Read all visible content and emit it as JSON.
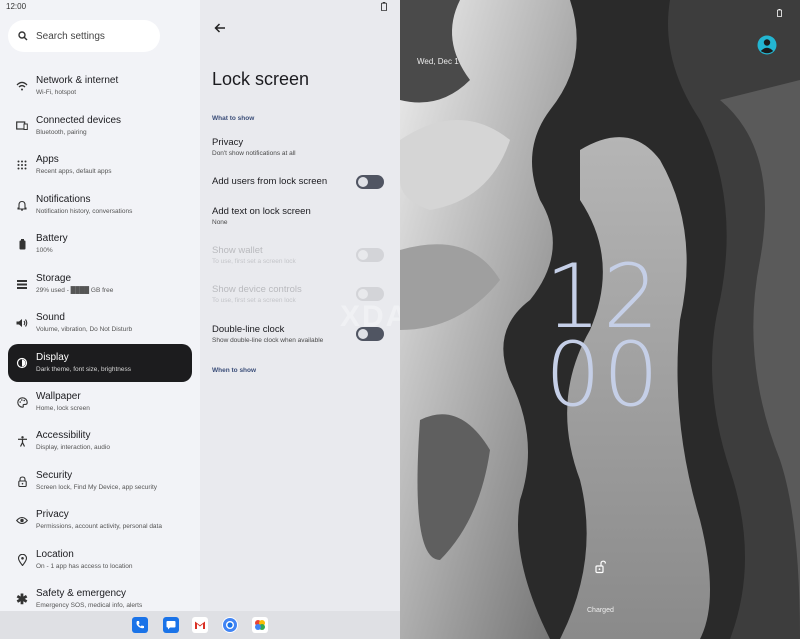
{
  "status": {
    "time": "12:00"
  },
  "search": {
    "placeholder": "Search settings"
  },
  "nav": [
    {
      "title": "Network & internet",
      "sub": "Wi-Fi, hotspot",
      "icon": "wifi-icon"
    },
    {
      "title": "Connected devices",
      "sub": "Bluetooth, pairing",
      "icon": "devices-icon"
    },
    {
      "title": "Apps",
      "sub": "Recent apps, default apps",
      "icon": "apps-grid-icon"
    },
    {
      "title": "Notifications",
      "sub": "Notification history, conversations",
      "icon": "bell-icon"
    },
    {
      "title": "Battery",
      "sub": "100%",
      "icon": "battery-icon"
    },
    {
      "title": "Storage",
      "sub": "29% used - ████ GB free",
      "icon": "storage-icon"
    },
    {
      "title": "Sound",
      "sub": "Volume, vibration, Do Not Disturb",
      "icon": "speaker-icon"
    },
    {
      "title": "Display",
      "sub": "Dark theme, font size, brightness",
      "icon": "brightness-icon"
    },
    {
      "title": "Wallpaper",
      "sub": "Home, lock screen",
      "icon": "palette-icon"
    },
    {
      "title": "Accessibility",
      "sub": "Display, interaction, audio",
      "icon": "accessibility-icon"
    },
    {
      "title": "Security",
      "sub": "Screen lock, Find My Device, app security",
      "icon": "lock-icon"
    },
    {
      "title": "Privacy",
      "sub": "Permissions, account activity, personal data",
      "icon": "eye-icon"
    },
    {
      "title": "Location",
      "sub": "On - 1 app has access to location",
      "icon": "location-pin-icon"
    },
    {
      "title": "Safety & emergency",
      "sub": "Emergency SOS, medical info, alerts",
      "icon": "asterisk-icon"
    }
  ],
  "detail": {
    "title": "Lock screen",
    "section_what": "What to show",
    "section_when": "When to show",
    "prefs": [
      {
        "title": "Privacy",
        "sub": "Don't show notifications at all"
      },
      {
        "title": "Add users from lock screen",
        "sub": ""
      },
      {
        "title": "Add text on lock screen",
        "sub": "None"
      },
      {
        "title": "Show wallet",
        "sub": "To use, first set a screen lock"
      },
      {
        "title": "Show device controls",
        "sub": "To use, first set a screen lock"
      },
      {
        "title": "Double-line clock",
        "sub": "Show double-line clock when available"
      }
    ]
  },
  "preview": {
    "date": "Wed, Dec 1",
    "clock_hours": "12",
    "clock_minutes": "00",
    "charged": "Charged",
    "watermark": "XDA"
  },
  "dock": [
    "phone-app-icon",
    "messages-app-icon",
    "gmail-app-icon",
    "chrome-app-icon",
    "photos-app-icon"
  ]
}
